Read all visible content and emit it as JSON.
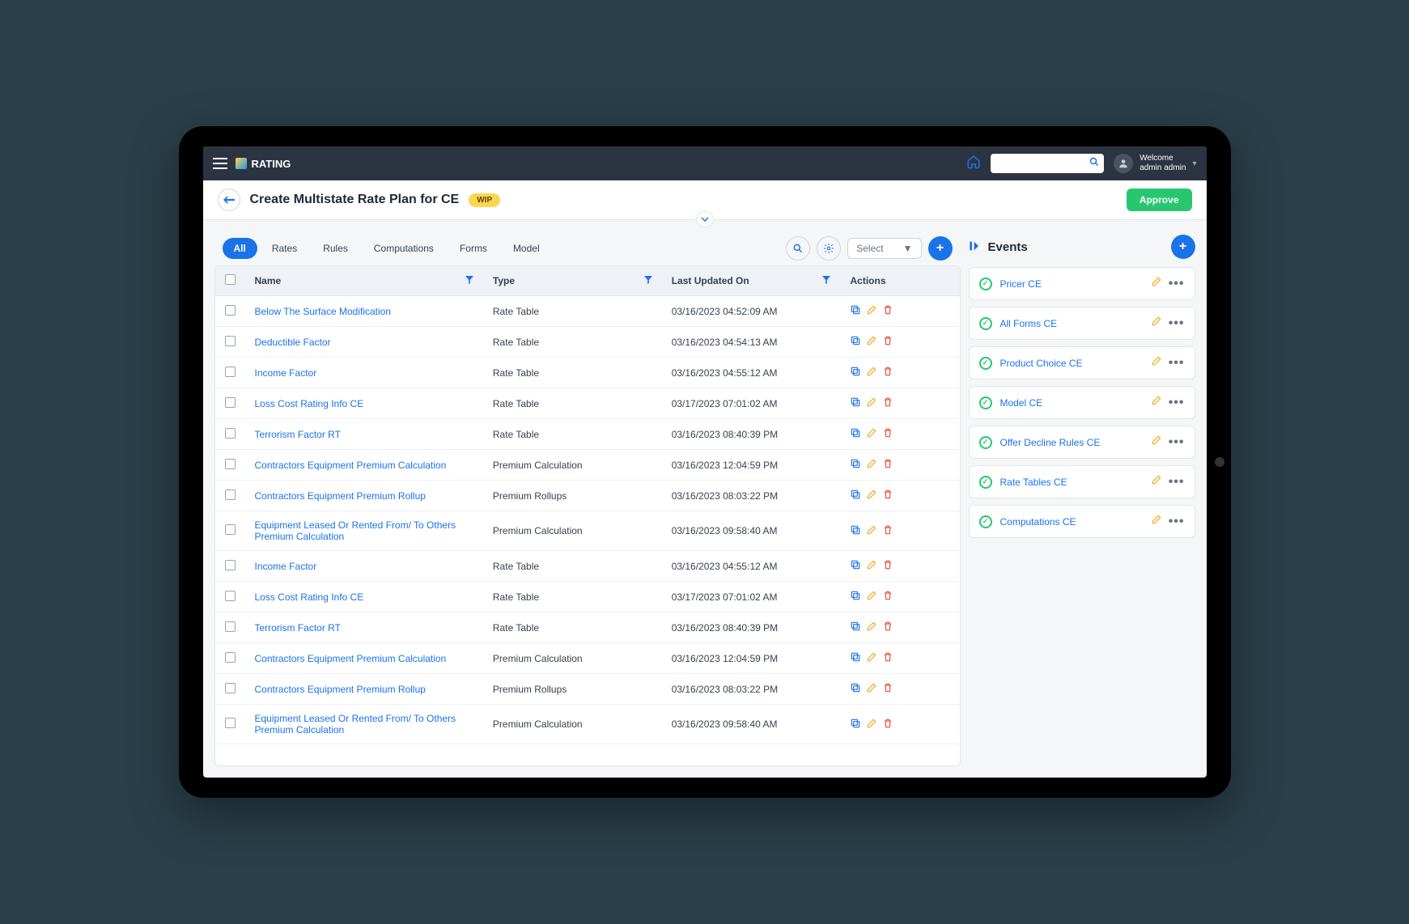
{
  "navbar": {
    "brand": "RATING",
    "welcome_label": "Welcome",
    "user_name": "admin admin"
  },
  "page": {
    "title": "Create Multistate Rate Plan for CE",
    "status_badge": "WIP",
    "approve_label": "Approve"
  },
  "tabs": [
    {
      "label": "All",
      "active": true
    },
    {
      "label": "Rates",
      "active": false
    },
    {
      "label": "Rules",
      "active": false
    },
    {
      "label": "Computations",
      "active": false
    },
    {
      "label": "Forms",
      "active": false
    },
    {
      "label": "Model",
      "active": false
    }
  ],
  "select_placeholder": "Select",
  "columns": {
    "name": "Name",
    "type": "Type",
    "updated": "Last Updated On",
    "actions": "Actions"
  },
  "rows": [
    {
      "name": "Below The Surface Modification",
      "type": "Rate Table",
      "updated": "03/16/2023 04:52:09 AM"
    },
    {
      "name": "Deductible Factor",
      "type": "Rate Table",
      "updated": "03/16/2023 04:54:13 AM"
    },
    {
      "name": "Income Factor",
      "type": "Rate Table",
      "updated": "03/16/2023 04:55:12 AM"
    },
    {
      "name": "Loss Cost Rating Info CE",
      "type": "Rate Table",
      "updated": "03/17/2023 07:01:02 AM"
    },
    {
      "name": "Terrorism Factor RT",
      "type": "Rate Table",
      "updated": "03/16/2023 08:40:39 PM"
    },
    {
      "name": "Contractors Equipment Premium Calculation",
      "type": "Premium Calculation",
      "updated": "03/16/2023 12:04:59 PM"
    },
    {
      "name": "Contractors Equipment Premium Rollup",
      "type": "Premium Rollups",
      "updated": "03/16/2023 08:03:22 PM"
    },
    {
      "name": "Equipment Leased Or Rented From/ To Others Premium Calculation",
      "type": "Premium Calculation",
      "updated": "03/16/2023 09:58:40 AM"
    },
    {
      "name": "Income Factor",
      "type": "Rate Table",
      "updated": "03/16/2023 04:55:12 AM"
    },
    {
      "name": "Loss Cost Rating Info CE",
      "type": "Rate Table",
      "updated": "03/17/2023 07:01:02 AM"
    },
    {
      "name": "Terrorism Factor RT",
      "type": "Rate Table",
      "updated": "03/16/2023 08:40:39 PM"
    },
    {
      "name": "Contractors Equipment Premium Calculation",
      "type": "Premium Calculation",
      "updated": "03/16/2023 12:04:59 PM"
    },
    {
      "name": "Contractors Equipment Premium Rollup",
      "type": "Premium Rollups",
      "updated": "03/16/2023 08:03:22 PM"
    },
    {
      "name": "Equipment Leased Or Rented From/ To Others Premium Calculation",
      "type": "Premium Calculation",
      "updated": "03/16/2023 09:58:40 AM"
    }
  ],
  "events": {
    "title": "Events",
    "items": [
      {
        "name": "Pricer CE"
      },
      {
        "name": "All Forms CE"
      },
      {
        "name": "Product Choice CE"
      },
      {
        "name": "Model CE"
      },
      {
        "name": "Offer Decline Rules CE"
      },
      {
        "name": "Rate Tables CE"
      },
      {
        "name": "Computations CE"
      }
    ]
  }
}
